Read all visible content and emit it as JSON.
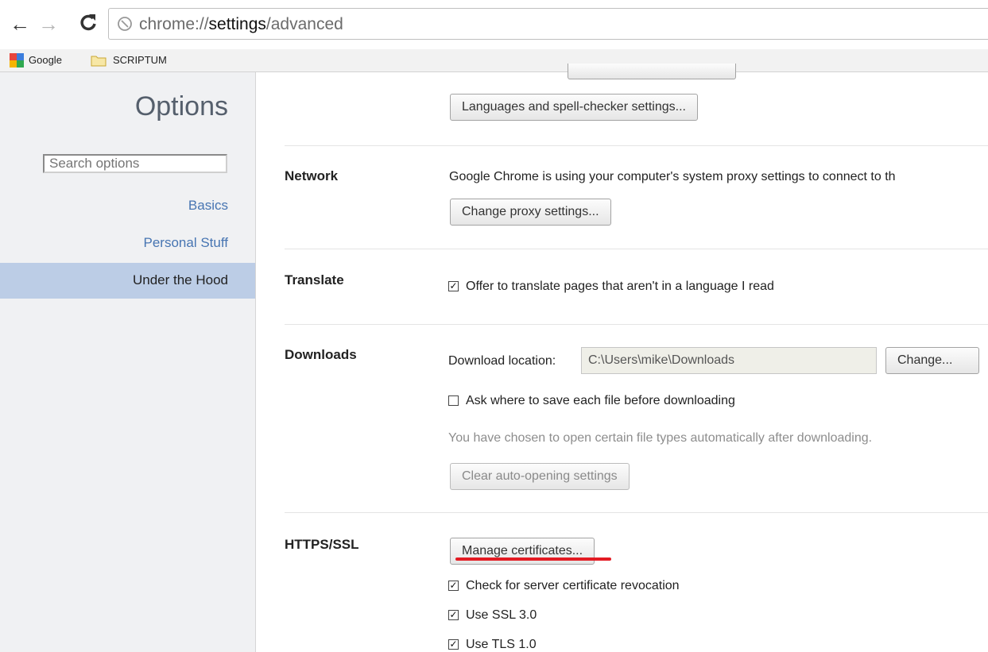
{
  "browser": {
    "url_prefix": "chrome://",
    "url_bold": "settings",
    "url_suffix": "/advanced",
    "bookmarks": [
      {
        "label": "Google",
        "icon": "google-icon"
      },
      {
        "label": "SCRIPTUM",
        "icon": "folder-icon"
      }
    ]
  },
  "sidebar": {
    "title": "Options",
    "search_placeholder": "Search options",
    "items": [
      {
        "label": "Basics"
      },
      {
        "label": "Personal Stuff"
      },
      {
        "label": "Under the Hood",
        "selected": true
      }
    ]
  },
  "content": {
    "languages_button": "Languages and spell-checker settings...",
    "network": {
      "heading": "Network",
      "description": "Google Chrome is using your computer's system proxy settings to connect to th",
      "button": "Change proxy settings..."
    },
    "translate": {
      "heading": "Translate",
      "checkbox_label": "Offer to translate pages that aren't in a language I read",
      "checked": true
    },
    "downloads": {
      "heading": "Downloads",
      "location_label": "Download location:",
      "location_value": "C:\\Users\\mike\\Downloads",
      "change_button": "Change...",
      "ask_label": "Ask where to save each file before downloading",
      "ask_checked": false,
      "auto_open_note": "You have chosen to open certain file types automatically after downloading.",
      "clear_button": "Clear auto-opening settings"
    },
    "https": {
      "heading": "HTTPS/SSL",
      "manage_button": "Manage certificates...",
      "options": [
        {
          "label": "Check for server certificate revocation",
          "checked": true
        },
        {
          "label": "Use SSL 3.0",
          "checked": true
        },
        {
          "label": "Use TLS 1.0",
          "checked": true
        }
      ]
    }
  },
  "colors": {
    "accent_link": "#4775b2",
    "selected_nav": "#bccde6",
    "annotation_red": "#e31b23"
  }
}
